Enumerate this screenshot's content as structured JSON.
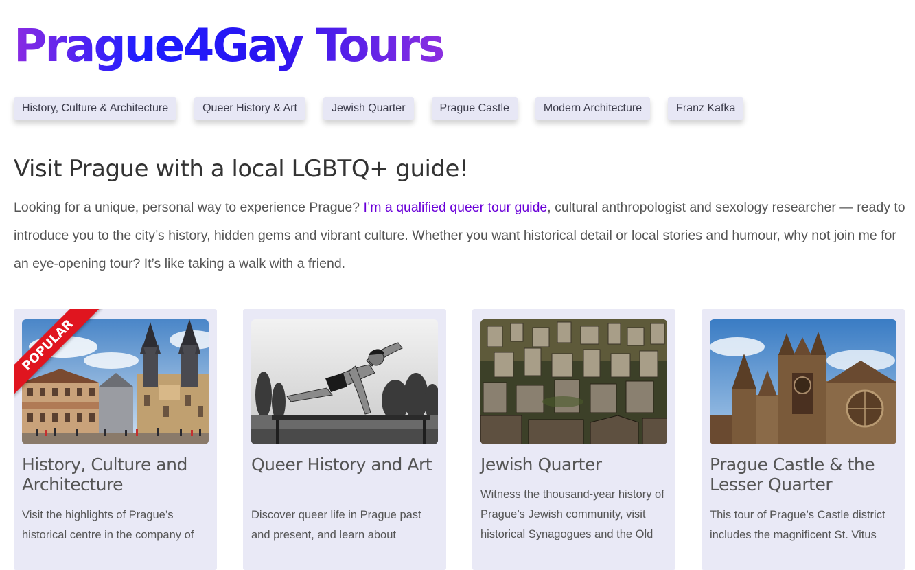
{
  "header": {
    "title": "Prague4Gay Tours"
  },
  "nav": {
    "tags": [
      "History, Culture & Architecture",
      "Queer History & Art",
      "Jewish Quarter",
      "Prague Castle",
      "Modern Architecture",
      "Franz Kafka"
    ]
  },
  "intro": {
    "heading": "Visit Prague with a local LGBTQ+ guide!",
    "text_before": "Looking for a unique, personal way to experience Prague? ",
    "link": "I’m a qualified queer tour guide",
    "text_after": ", cultural anthropologist and sexology researcher — ready to introduce you to the city’s history, hidden gems and vibrant culture. Whether you want historical detail or local stories and humour, why not join me for an eye-opening tour? It’s like taking a walk with a friend."
  },
  "cards": [
    {
      "badge": "POPULAR",
      "title": "History, Culture and Architecture",
      "text": "Visit the highlights of Prague’s historical centre in the company of",
      "image_icon": "old-town-square-photo"
    },
    {
      "title": "Queer History and Art",
      "text": "Discover queer life in Prague past and present, and learn about",
      "image_icon": "gymnast-photo"
    },
    {
      "title": "Jewish Quarter",
      "text": "Witness the thousand-year history of Prague’s Jewish community, visit historical Synagogues and the Old",
      "image_icon": "jewish-cemetery-photo"
    },
    {
      "title": "Prague Castle & the Lesser Quarter",
      "text": "This tour of Prague’s Castle district includes the magnificent St. Vitus",
      "image_icon": "st-vitus-cathedral-photo"
    }
  ],
  "colors": {
    "title_gradient": [
      "#8a2be2",
      "#1d1dff",
      "#8b2fe0"
    ],
    "link": "#6a00d8",
    "card_bg": "#e9e9f6",
    "badge": "#e0151f"
  }
}
